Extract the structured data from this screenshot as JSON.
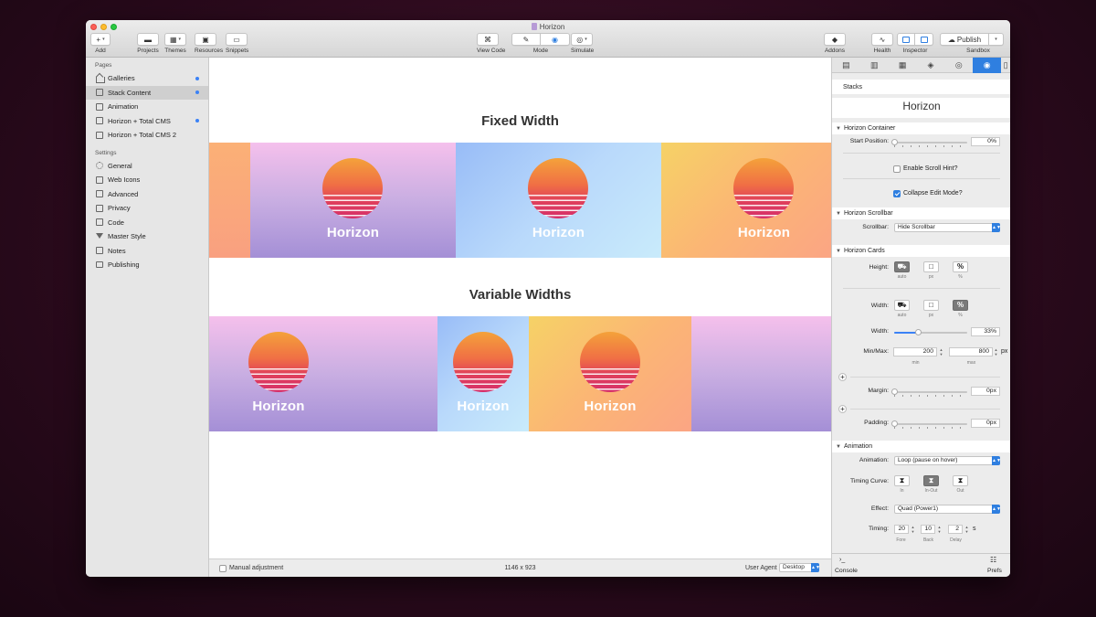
{
  "window": {
    "title": "Horizon"
  },
  "toolbar": {
    "add": "Add",
    "projects": "Projects",
    "themes": "Themes",
    "resources": "Resources",
    "snippets": "Snippets",
    "view_code": "View Code",
    "mode": "Mode",
    "simulate": "Simulate",
    "addons": "Addons",
    "health": "Health",
    "inspector": "Inspector",
    "publish": "Publish",
    "sandbox": "Sandbox"
  },
  "sidebar": {
    "pages_header": "Pages",
    "pages": [
      {
        "label": "Galleries",
        "icon": "home-icon",
        "dot": true
      },
      {
        "label": "Stack Content",
        "icon": "page-icon",
        "dot": true,
        "selected": true
      },
      {
        "label": "Animation",
        "icon": "page-icon",
        "dot": false
      },
      {
        "label": "Horizon + Total CMS",
        "icon": "page-icon",
        "dot": true
      },
      {
        "label": "Horizon + Total CMS 2",
        "icon": "page-icon",
        "dot": false
      }
    ],
    "settings_header": "Settings",
    "settings": [
      {
        "label": "General",
        "icon": "gear-icon"
      },
      {
        "label": "Web Icons",
        "icon": "image-icon"
      },
      {
        "label": "Advanced",
        "icon": "advanced-icon"
      },
      {
        "label": "Privacy",
        "icon": "privacy-icon"
      },
      {
        "label": "Code",
        "icon": "code-icon"
      },
      {
        "label": "Master Style",
        "icon": "funnel-icon"
      },
      {
        "label": "Notes",
        "icon": "notes-icon"
      },
      {
        "label": "Publishing",
        "icon": "folder-icon"
      }
    ]
  },
  "canvas": {
    "fixed_title": "Fixed Width",
    "variable_title": "Variable Widths",
    "card_label": "Horizon"
  },
  "status": {
    "manual": "Manual adjustment",
    "dimensions": "1146 x 923",
    "user_agent_label": "User Agent",
    "user_agent_value": "Desktop"
  },
  "inspector": {
    "stacks_label": "Stacks",
    "stack_name": "Horizon",
    "container": {
      "title": "Horizon Container",
      "start_position_label": "Start Position:",
      "start_position_value": "0%",
      "start_position_fraction": 0.0,
      "scroll_hint": "Enable Scroll Hint?",
      "collapse_edit": "Collapse Edit Mode?"
    },
    "scrollbar": {
      "title": "Horizon Scrollbar",
      "label": "Scrollbar:",
      "value": "Hide Scrollbar"
    },
    "cards": {
      "title": "Horizon Cards",
      "height_label": "Height:",
      "width_label": "Width:",
      "opt_auto": "auto",
      "opt_px": "px",
      "opt_pct": "%",
      "width_slider_label": "Width:",
      "width_value": "33%",
      "width_fraction": 0.33,
      "minmax_label": "Min/Max:",
      "min_value": "200",
      "max_value": "800",
      "unit": "px",
      "min_label": "min",
      "max_label": "max",
      "margin_label": "Margin:",
      "margin_value": "0px",
      "padding_label": "Padding:",
      "padding_value": "0px"
    },
    "animation": {
      "title": "Animation",
      "animation_label": "Animation:",
      "animation_value": "Loop (pause on hover)",
      "timing_curve_label": "Timing Curve:",
      "curve_in": "In",
      "curve_inout": "In-Out",
      "curve_out": "Out",
      "effect_label": "Effect:",
      "effect_value": "Quad (Power1)",
      "timing_label": "Timing:",
      "fore": "20",
      "back": "10",
      "delay": "2",
      "unit": "s",
      "fore_label": "Fore",
      "back_label": "Back",
      "delay_label": "Delay"
    },
    "footer": {
      "console": "Console",
      "prefs": "Prefs"
    }
  },
  "colors": {
    "accent": "#2f7fe0",
    "sidebar_dot": "#3b82f6"
  }
}
